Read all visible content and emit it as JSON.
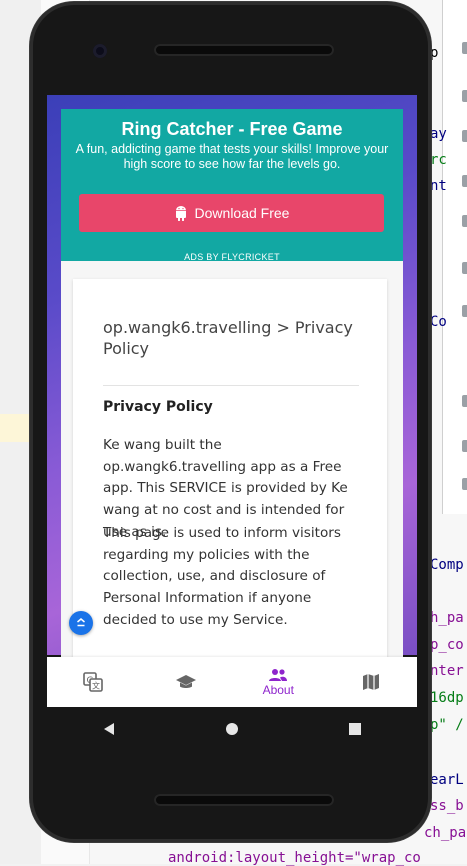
{
  "ide": {
    "lines": [
      {
        "text": "p",
        "cls": "gray"
      },
      {
        "text": "ay",
        "cls": "navy"
      },
      {
        "text": "rc",
        "cls": "green"
      },
      {
        "text": "nt",
        "cls": "navy"
      },
      {
        "text": "Co",
        "cls": "navy"
      },
      {
        "text": "Comp",
        "cls": "navy"
      },
      {
        "text": "h_pa",
        "cls": "purple"
      },
      {
        "text": "p_co",
        "cls": "purple"
      },
      {
        "text": "nter",
        "cls": "purple"
      },
      {
        "text": "16dp",
        "cls": "green"
      },
      {
        "text": "p\" /",
        "cls": "green"
      },
      {
        "text": "earL",
        "cls": "navy"
      },
      {
        "text": "ss_b",
        "cls": "purple"
      },
      {
        "text": "ch_pa",
        "cls": "purple"
      },
      {
        "text": "android:layout_height=\"wrap_co",
        "cls": "purple"
      }
    ]
  },
  "ad": {
    "title": "Ring Catcher - Free Game",
    "description": "A fun, addicting game that tests your skills! Improve your high score to see how far the levels go.",
    "button_label": "Download Free",
    "note": "ADS BY FLYCRICKET"
  },
  "policy": {
    "page_title": "op.wangk6.travelling > Privacy Policy",
    "heading": "Privacy Policy",
    "paragraph_1": "Ke wang built the op.wangk6.travelling app as a Free app. This SERVICE is provided by Ke wang at no cost and is intended for use as is.",
    "paragraph_2": "This page is used to inform visitors regarding my policies with the collection, use, and disclosure of Personal Information if anyone decided to use my Service."
  },
  "bottom_nav": {
    "items": [
      {
        "icon": "translate-icon",
        "label": ""
      },
      {
        "icon": "school-icon",
        "label": ""
      },
      {
        "icon": "people-icon",
        "label": "About"
      },
      {
        "icon": "map-icon",
        "label": ""
      }
    ],
    "active_color": "#8e24cc",
    "inactive_color": "#666666"
  },
  "colors": {
    "ad_background": "#12a8a3",
    "ad_button": "#e8466a",
    "gradient_start": "#3b3fb8",
    "gradient_end": "#a865d8"
  }
}
